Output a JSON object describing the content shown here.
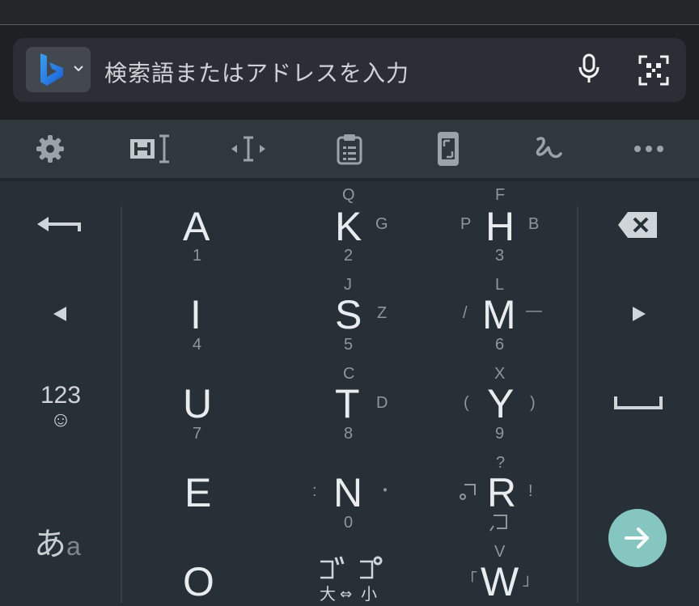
{
  "browser": {
    "search_engine": "Bing",
    "search_engine_icon": "bing-logo-icon",
    "placeholder": "検索語またはアドレスを入力",
    "icons": [
      "chevron-down-icon",
      "microphone-icon",
      "qr-scan-icon"
    ]
  },
  "toolbar": {
    "icons": [
      "gear-icon",
      "heading-cursor-icon",
      "text-cursor-icon",
      "clipboard-icon",
      "one-hand-mode-icon",
      "handwriting-icon",
      "more-icon"
    ]
  },
  "keyboard": {
    "left": {
      "numbers_top": "123",
      "numbers_bottom": "☺",
      "kana_big": "あ",
      "kana_small": "a"
    },
    "keys": [
      {
        "main": "A",
        "bottom": "1"
      },
      {
        "main": "K",
        "top": "Q",
        "right": "G",
        "bottom": "2"
      },
      {
        "main": "H",
        "top": "F",
        "left": "P",
        "right": "B",
        "bottom": "3"
      },
      {
        "main": "I",
        "bottom": "4"
      },
      {
        "main": "S",
        "top": "J",
        "right": "Z",
        "bottom": "5"
      },
      {
        "main": "M",
        "top": "L",
        "left": "/",
        "right": "—",
        "bottom": "6"
      },
      {
        "main": "U",
        "bottom": "7"
      },
      {
        "main": "T",
        "top": "C",
        "right": "D",
        "bottom": "8"
      },
      {
        "main": "Y",
        "top": "X",
        "left": "(",
        "right": ")",
        "bottom": "9"
      },
      {
        "main": "E"
      },
      {
        "main": "N",
        "left": ":",
        "right": "・",
        "bottom": "0"
      },
      {
        "main": "R",
        "top": "?",
        "right": "!"
      },
      {
        "main": "O"
      },
      {
        "main": "W",
        "top": "V",
        "left": "「",
        "right": "」"
      }
    ],
    "size_toggle": {
      "left": "大",
      "mid": "⇔",
      "right": "小"
    },
    "accent_color": "#85c7c0"
  }
}
